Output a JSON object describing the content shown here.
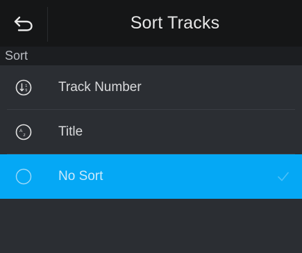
{
  "header": {
    "back_icon": "undo-arrow-icon",
    "title": "Sort Tracks"
  },
  "section": {
    "label": "Sort"
  },
  "options": [
    {
      "label": "Track Number",
      "icon": "sort-numeric-icon",
      "selected": false
    },
    {
      "label": "Title",
      "icon": "sort-alphabetical-icon",
      "selected": false
    },
    {
      "label": "No Sort",
      "icon": "circle-icon",
      "selected": true
    }
  ],
  "colors": {
    "selected_background": "#05a8f5",
    "header_background": "#151617",
    "page_background": "#2b2e33"
  }
}
